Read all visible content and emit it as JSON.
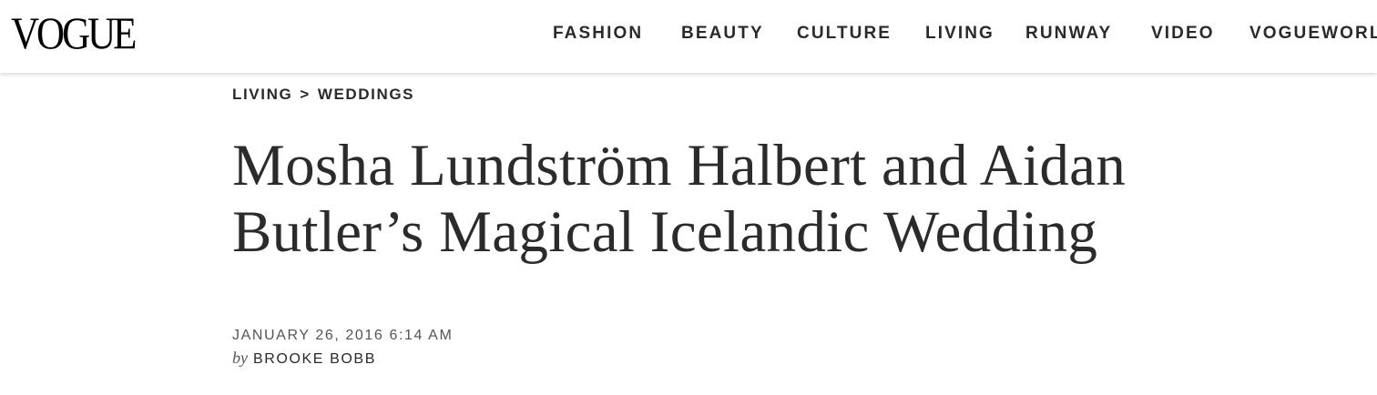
{
  "header": {
    "logo": "VOGUE",
    "nav": [
      {
        "label": "FASHION"
      },
      {
        "label": "BEAUTY"
      },
      {
        "label": "CULTURE"
      },
      {
        "label": "LIVING"
      },
      {
        "label": "RUNWAY"
      },
      {
        "label": "VIDEO"
      },
      {
        "label": "VOGUEWORLD"
      }
    ]
  },
  "article": {
    "breadcrumb": {
      "section": "LIVING",
      "separator": ">",
      "subsection": "WEDDINGS"
    },
    "headline_lines": [
      "Mosha Lundström Halbert and Aidan",
      "Butler’s Magical Icelandic Wedding"
    ],
    "date": "JANUARY 26, 2016 6:14 AM",
    "byline": {
      "prefix": "by",
      "author": "BROOKE BOBB"
    }
  },
  "colors": {
    "text": "#2a2a2a",
    "meta": "#555555",
    "background": "#ffffff"
  }
}
